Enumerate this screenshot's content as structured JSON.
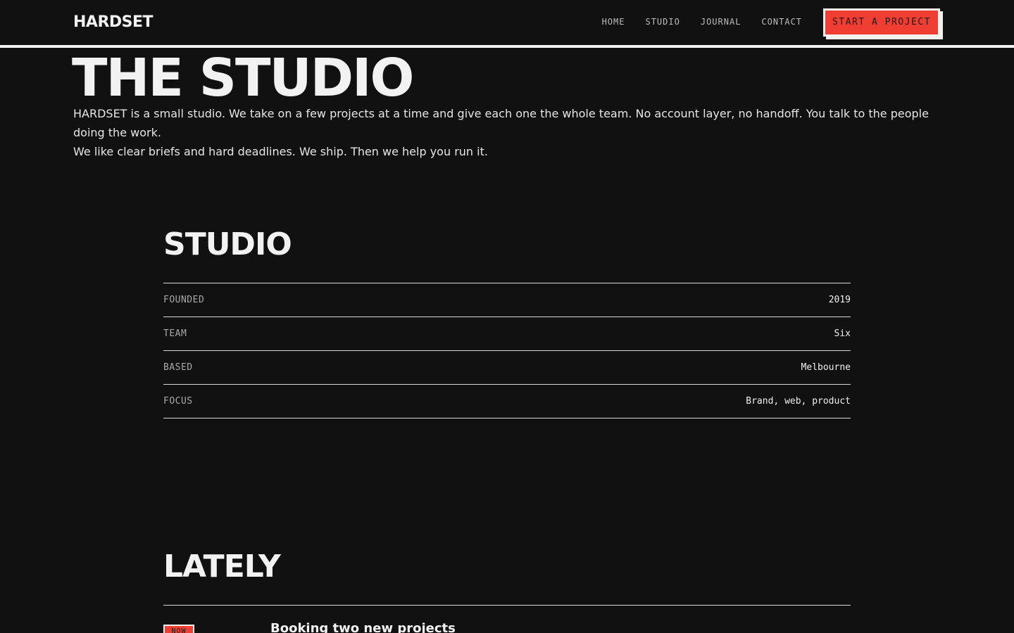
{
  "header": {
    "logo": "HARDSET",
    "nav": [
      {
        "label": "HOME"
      },
      {
        "label": "STUDIO"
      },
      {
        "label": "JOURNAL"
      },
      {
        "label": "CONTACT"
      }
    ],
    "cta_label": "START A PROJECT"
  },
  "hero": {
    "title": "THE STUDIO",
    "intro": [
      "HARDSET is a small studio. We take on a few projects at a time and give each one the whole team. No account layer, no handoff. You talk to the people doing the work.",
      "We like clear briefs and hard deadlines. We ship. Then we help you run it."
    ]
  },
  "studio": {
    "title": "STUDIO",
    "facts": [
      {
        "label": "FOUNDED",
        "value": "2019"
      },
      {
        "label": "TEAM",
        "value": "Six"
      },
      {
        "label": "BASED",
        "value": "Melbourne"
      },
      {
        "label": "FOCUS",
        "value": "Brand, web, product"
      }
    ]
  },
  "lately": {
    "title": "LATELY",
    "items": [
      {
        "badge": "NOW",
        "title": "Booking two new projects"
      }
    ]
  },
  "colors": {
    "background": "#111111",
    "accent": "#f03e33",
    "foreground": "#f2f2f2"
  }
}
